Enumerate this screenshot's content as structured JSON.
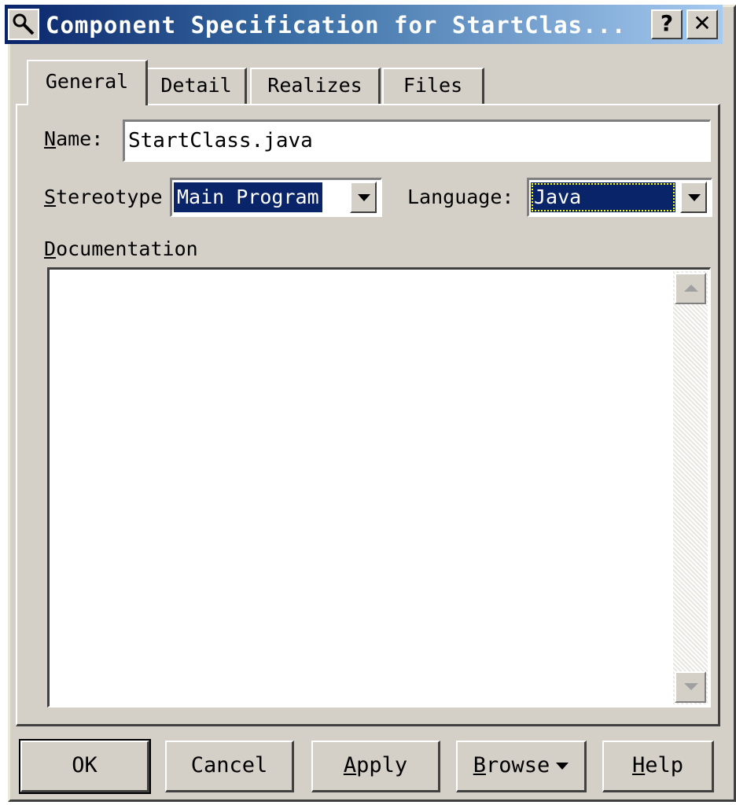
{
  "window": {
    "title": "Component Specification for StartClas...",
    "help_label": "?",
    "close_label": "✕",
    "icon": "magnifier-icon"
  },
  "tabs": [
    {
      "label": "General",
      "active": true
    },
    {
      "label": "Detail",
      "active": false
    },
    {
      "label": "Realizes",
      "active": false
    },
    {
      "label": "Files",
      "active": false
    }
  ],
  "general": {
    "name_label_mnemonic": "N",
    "name_label_rest": "ame:",
    "name_value": "StartClass.java",
    "stereotype_label_mnemonic": "S",
    "stereotype_label_rest": "tereotype",
    "stereotype_value": "Main Program",
    "language_label": "Language:",
    "language_value": "Java",
    "documentation_label_mnemonic": "D",
    "documentation_label_rest": "ocumentation",
    "documentation_value": ""
  },
  "buttons": {
    "ok": "OK",
    "cancel": "Cancel",
    "apply_mnemonic": "A",
    "apply_rest": "pply",
    "browse_mnemonic": "B",
    "browse_rest": "rowse",
    "help_mnemonic": "H",
    "help_rest": "elp"
  }
}
